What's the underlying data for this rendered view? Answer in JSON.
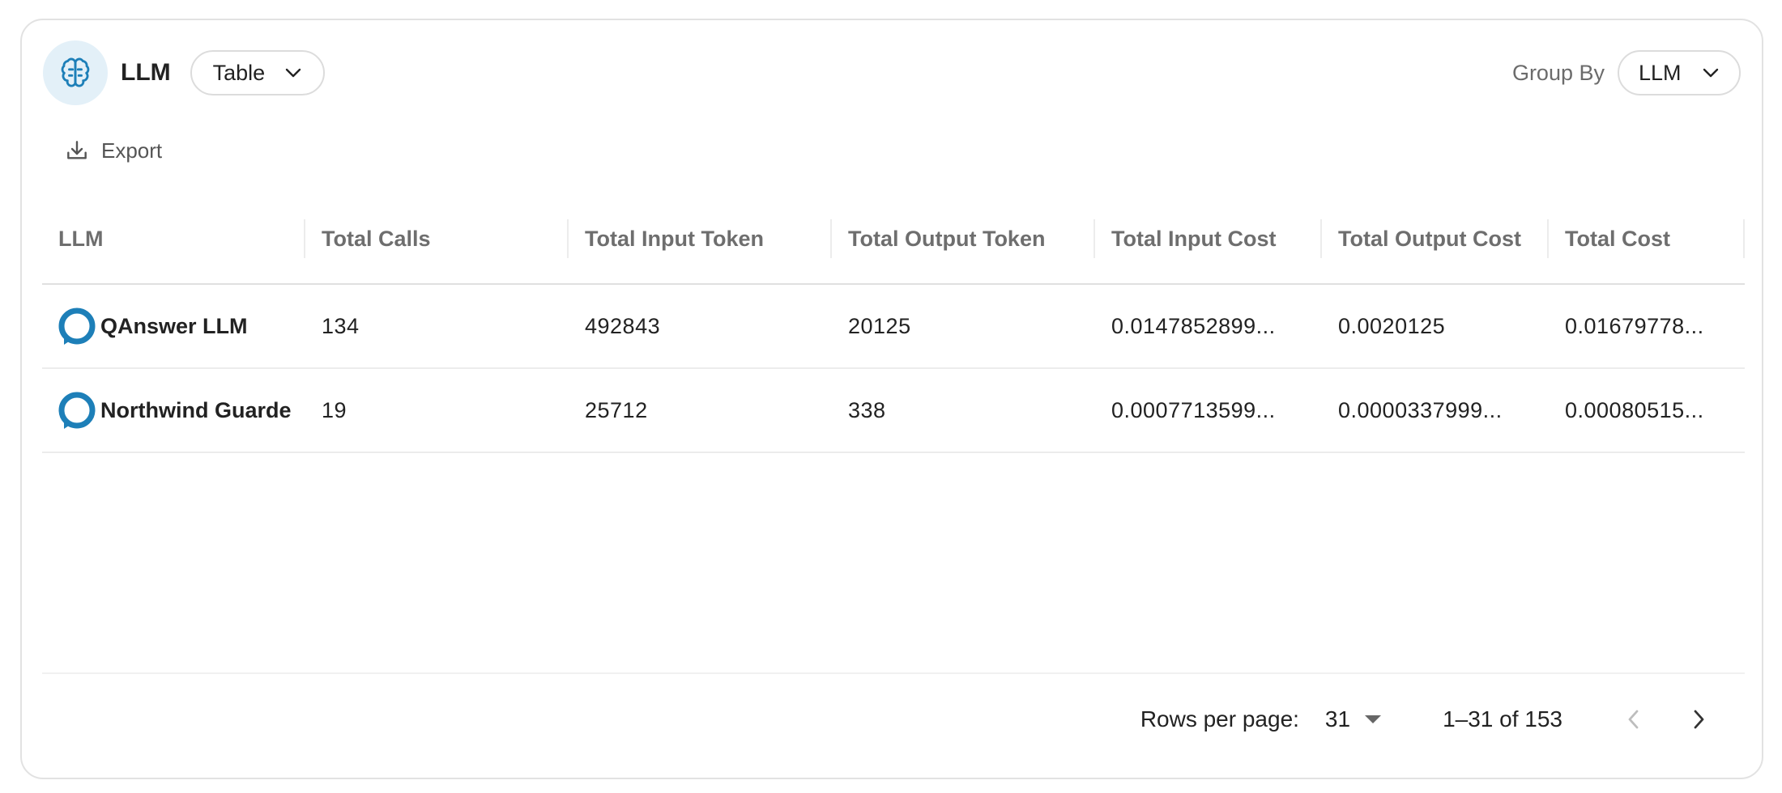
{
  "header": {
    "title": "LLM",
    "view_select": "Table",
    "group_by_label": "Group By",
    "group_by_value": "LLM",
    "icon": "brain-icon"
  },
  "toolbar": {
    "export_label": "Export",
    "export_icon": "download-icon"
  },
  "table": {
    "columns": [
      "LLM",
      "Total Calls",
      "Total Input Token",
      "Total Output Token",
      "Total Input Cost",
      "Total Output Cost",
      "Total Cost"
    ],
    "rows": [
      {
        "llm": "QAnswer LLM",
        "total_calls": "134",
        "total_input_token": "492843",
        "total_output_token": "20125",
        "total_input_cost": "0.0147852899...",
        "total_output_cost": "0.0020125",
        "total_cost": "0.01679778..."
      },
      {
        "llm": "Northwind Guarde",
        "total_calls": "19",
        "total_input_token": "25712",
        "total_output_token": "338",
        "total_input_cost": "0.0007713599...",
        "total_output_cost": "0.0000337999...",
        "total_cost": "0.00080515..."
      }
    ]
  },
  "pagination": {
    "rows_per_page_label": "Rows per page:",
    "rows_per_page": "31",
    "range": "1–31 of 153"
  },
  "colors": {
    "accent": "#1d7fb8",
    "icon_bg": "#e3f0f8",
    "border": "#e2e2e2"
  }
}
